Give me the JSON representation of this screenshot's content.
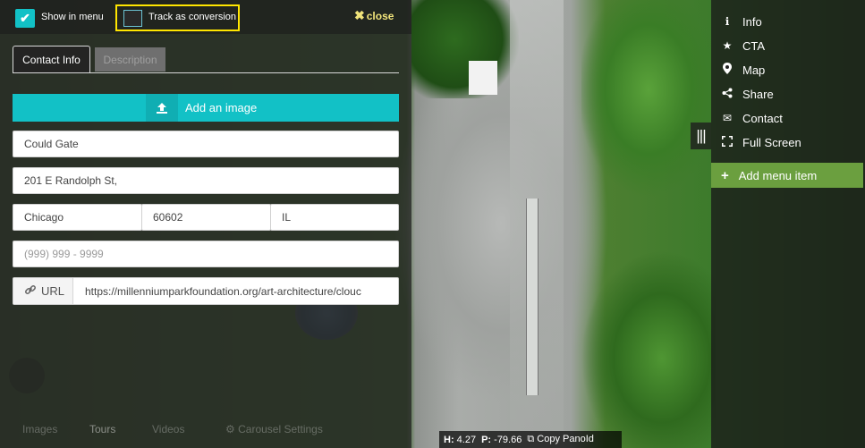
{
  "topbar": {
    "show_in_menu_label": "Show in menu",
    "show_in_menu_checked": true,
    "track_conversion_label": "Track as conversion",
    "track_conversion_checked": false,
    "close_label": "close"
  },
  "tabs": {
    "contact_info": "Contact Info",
    "description": "Description"
  },
  "form": {
    "add_image_label": "Add an image",
    "name_value": "Could Gate",
    "address_value": "201 E Randolph St,",
    "city_value": "Chicago",
    "zip_value": "60602",
    "state_value": "IL",
    "phone_placeholder": "(999) 999 - 9999",
    "url_addon_label": "URL",
    "url_value": "https://millenniumparkfoundation.org/art-architecture/clouc"
  },
  "bottom_tabs": {
    "images": "Images",
    "tours": "Tours",
    "videos": "Videos",
    "carousel_settings": "Carousel Settings"
  },
  "statusbar": {
    "h_label": "H:",
    "h_value": "4.27",
    "p_label": "P:",
    "p_value": "-79.66",
    "copy_label": "Copy PanoId"
  },
  "menu": {
    "items": [
      {
        "label": "Info",
        "icon": "info-icon"
      },
      {
        "label": "CTA",
        "icon": "star-icon"
      },
      {
        "label": "Map",
        "icon": "map-pin-icon"
      },
      {
        "label": "Share",
        "icon": "share-icon"
      },
      {
        "label": "Contact",
        "icon": "envelope-icon"
      },
      {
        "label": "Full Screen",
        "icon": "fullscreen-icon"
      }
    ],
    "add_label": "Add menu item"
  },
  "colors": {
    "accent_teal": "#12c1c6",
    "add_menu_green": "#6b9f3f",
    "highlight_yellow": "#ffe600",
    "close_yellow": "#f0e37a"
  }
}
